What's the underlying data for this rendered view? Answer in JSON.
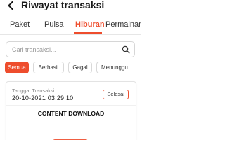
{
  "header": {
    "title": "Riwayat transaksi"
  },
  "tabs": [
    {
      "label": "Paket",
      "active": false
    },
    {
      "label": "Pulsa",
      "active": false
    },
    {
      "label": "Hiburan",
      "active": true
    },
    {
      "label": "Permainan",
      "active": false
    }
  ],
  "search": {
    "placeholder": "Cari transaksi...",
    "value": ""
  },
  "filters": [
    {
      "label": "Semua",
      "active": true
    },
    {
      "label": "Berhasil",
      "active": false
    },
    {
      "label": "Gagal",
      "active": false
    },
    {
      "label": "Menunggu",
      "active": false
    }
  ],
  "transaction": {
    "date_label": "Tanggal Transaksi",
    "date": "20-10-2021 03:29:10",
    "status": "Selesai",
    "product": "CONTENT DOWNLOAD"
  },
  "colors": {
    "accent": "#ee4d2d",
    "text": "#1f1f1f",
    "muted": "#8a8a8a",
    "border": "#d9d9d9"
  },
  "icons": {
    "back": "arrow-left-icon",
    "search": "search-icon"
  }
}
